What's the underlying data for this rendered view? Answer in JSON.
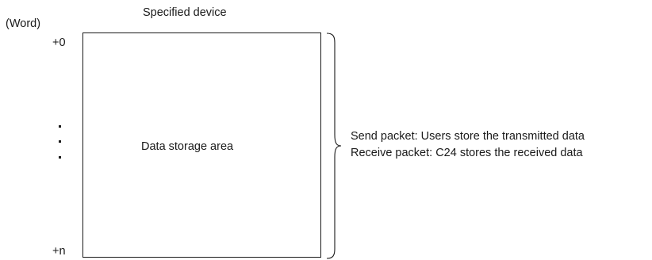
{
  "diagram": {
    "unit_label": "(Word)",
    "device_label": "Specified device",
    "offset_start": "+0",
    "offset_end": "+n",
    "area_label": "Data storage area",
    "notes": {
      "send": "Send packet: Users store the transmitted data",
      "receive": "Receive packet: C24 stores the received data"
    }
  }
}
